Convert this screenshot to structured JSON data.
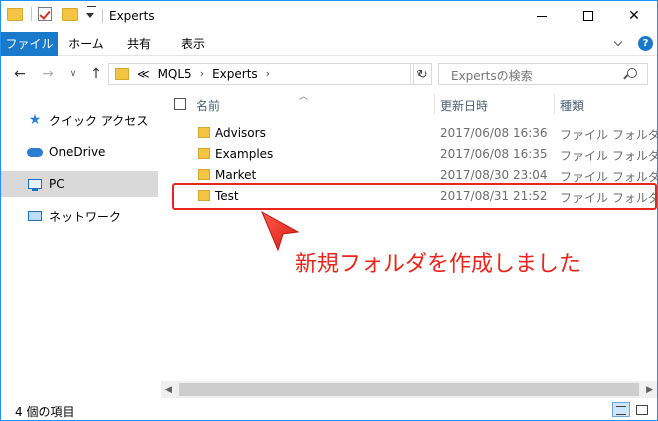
{
  "window": {
    "title": "Experts"
  },
  "ribbon": {
    "tabs": [
      {
        "label": "ファイル",
        "active": true
      },
      {
        "label": "ホーム"
      },
      {
        "label": "共有"
      },
      {
        "label": "表示"
      }
    ],
    "help_label": "?"
  },
  "nav": {
    "back_icon": "←",
    "forward_icon": "→",
    "recent_icon": "∨",
    "up_icon": "↑",
    "breadcrumbs": [
      "≪",
      "MQL5",
      "Experts"
    ],
    "refresh_icon": "↻",
    "dropdown_icon": "∨",
    "search_placeholder": "Expertsの検索"
  },
  "sidebar": {
    "items": [
      {
        "label": "クイック アクセス",
        "icon": "star-icon"
      },
      {
        "label": "OneDrive",
        "icon": "cloud-icon"
      },
      {
        "label": "PC",
        "icon": "computer-icon",
        "selected": true
      },
      {
        "label": "ネットワーク",
        "icon": "network-icon"
      }
    ]
  },
  "filelist": {
    "headers": {
      "name": "名前",
      "date": "更新日時",
      "type": "種類"
    },
    "rows": [
      {
        "name": "Advisors",
        "date": "2017/06/08 16:36",
        "type": "ファイル フォルダー"
      },
      {
        "name": "Examples",
        "date": "2017/06/08 16:35",
        "type": "ファイル フォルダー"
      },
      {
        "name": "Market",
        "date": "2017/08/30 23:04",
        "type": "ファイル フォルダー"
      },
      {
        "name": "Test",
        "date": "2017/08/31 21:52",
        "type": "ファイル フォルダー"
      }
    ]
  },
  "annotation": {
    "text": "新規フォルダを作成しました",
    "color": "#e8261d"
  },
  "status": {
    "text": "4 個の項目"
  },
  "colors": {
    "accent": "#1979ca",
    "highlight": "#e8261d",
    "folder": "#f4c542"
  }
}
